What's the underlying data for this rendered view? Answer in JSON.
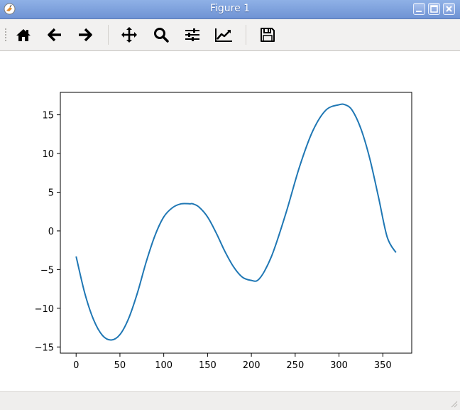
{
  "window": {
    "title": "Figure 1",
    "controls": [
      "minimize",
      "maximize",
      "close"
    ]
  },
  "toolbar": {
    "buttons": [
      {
        "name": "home",
        "icon": "home-icon"
      },
      {
        "name": "back",
        "icon": "arrow-left-icon"
      },
      {
        "name": "forward",
        "icon": "arrow-right-icon"
      },
      {
        "name": "pan",
        "icon": "move-icon"
      },
      {
        "name": "zoom",
        "icon": "magnifier-icon"
      },
      {
        "name": "configure-subplots",
        "icon": "sliders-icon"
      },
      {
        "name": "edit-axis",
        "icon": "line-chart-icon"
      },
      {
        "name": "save",
        "icon": "floppy-disk-icon"
      }
    ]
  },
  "status": {
    "text": ""
  },
  "chart_data": {
    "type": "line",
    "title": "",
    "xlabel": "",
    "ylabel": "",
    "xlim": [
      -18,
      383
    ],
    "ylim": [
      -15.8,
      17.9
    ],
    "xticks": [
      0,
      50,
      100,
      150,
      200,
      250,
      300,
      350
    ],
    "yticks": [
      -15,
      -10,
      -5,
      0,
      5,
      10,
      15
    ],
    "xtick_labels": [
      "0",
      "50",
      "100",
      "150",
      "200",
      "250",
      "300",
      "350"
    ],
    "ytick_labels": [
      "−15",
      "−10",
      "−5",
      "0",
      "5",
      "10",
      "15"
    ],
    "grid": false,
    "legend": "none",
    "series": [
      {
        "color": "#1f77b4",
        "x": [
          0,
          10,
          20,
          30,
          40,
          50,
          60,
          70,
          80,
          90,
          100,
          110,
          120,
          130,
          133,
          140,
          150,
          160,
          170,
          180,
          190,
          200,
          207,
          215,
          225,
          240,
          255,
          270,
          285,
          300,
          307,
          315,
          325,
          335,
          345,
          355,
          365
        ],
        "y": [
          -3.3,
          -8.1,
          -11.5,
          -13.5,
          -14.1,
          -13.4,
          -11.3,
          -8.0,
          -4.0,
          -0.6,
          1.8,
          3.0,
          3.5,
          3.5,
          3.5,
          3.1,
          1.8,
          -0.3,
          -2.7,
          -4.7,
          -6.0,
          -6.4,
          -6.4,
          -5.2,
          -2.7,
          2.5,
          8.3,
          12.9,
          15.6,
          16.3,
          16.3,
          15.6,
          13.2,
          9.4,
          4.4,
          -0.8,
          -2.8
        ]
      }
    ]
  }
}
